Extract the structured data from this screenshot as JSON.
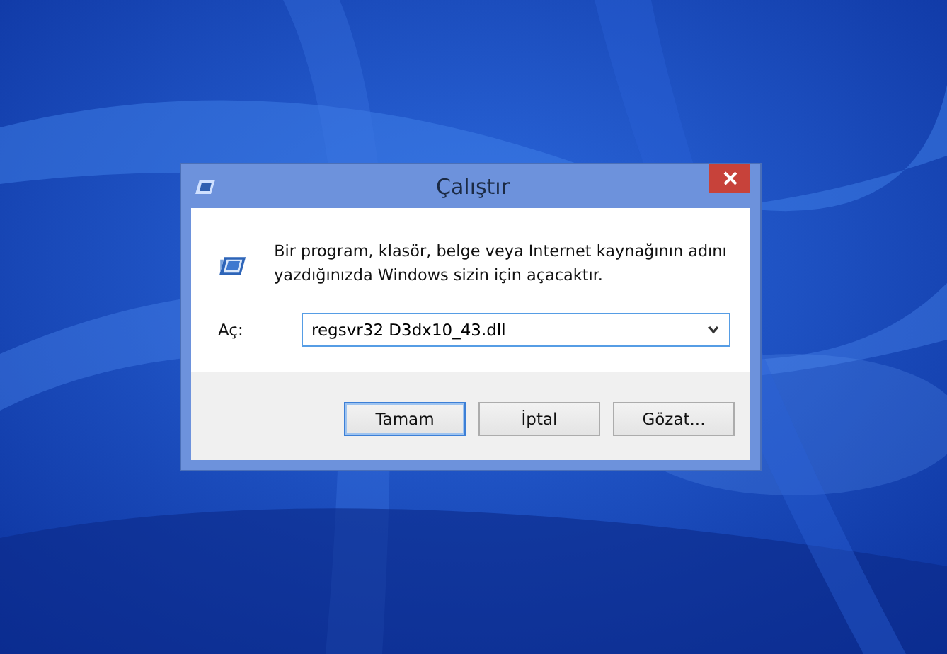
{
  "window": {
    "title": "Çalıştır",
    "message": "Bir program, klasör, belge veya Internet kaynağının adını yazdığınızda Windows sizin için açacaktır.",
    "open_field": {
      "label": "Aç:",
      "value": "regsvr32 D3dx10_43.dll"
    },
    "buttons": [
      {
        "label": "Tamam",
        "default": true
      },
      {
        "label": "İptal",
        "default": false
      },
      {
        "label": "Gözat...",
        "default": false
      }
    ]
  }
}
